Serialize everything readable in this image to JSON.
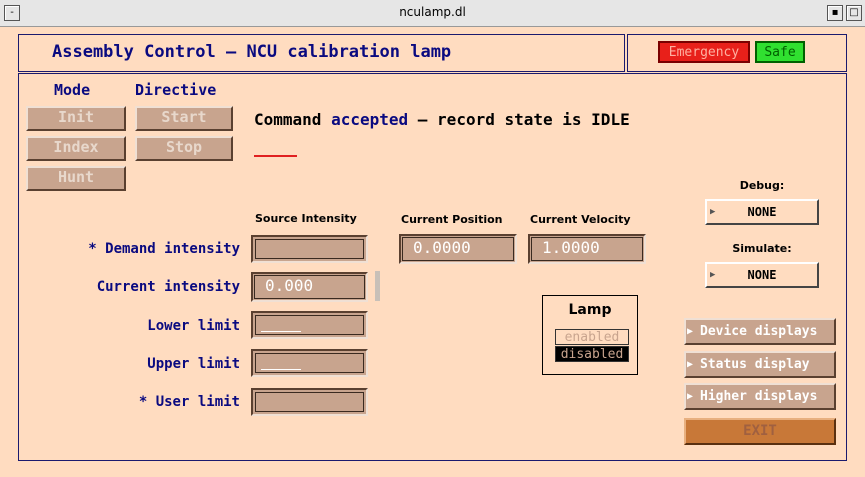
{
  "window": {
    "title": "nculamp.dl"
  },
  "header": {
    "title": "Assembly Control – NCU calibration lamp",
    "emergency_label": "Emergency",
    "safe_label": "Safe"
  },
  "mode": {
    "heading": "Mode",
    "buttons": [
      "Init",
      "Index",
      "Hunt"
    ]
  },
  "directive": {
    "heading": "Directive",
    "buttons": [
      "Start",
      "Stop"
    ]
  },
  "status": {
    "prefix": "Command",
    "word": "accepted",
    "suffix": "– record state is IDLE"
  },
  "columns": {
    "source_intensity": "Source Intensity",
    "current_position": "Current Position",
    "current_velocity": "Current Velocity"
  },
  "rows": {
    "demand_intensity": "* Demand intensity",
    "current_intensity": "Current intensity",
    "lower_limit": "Lower limit",
    "upper_limit": "Upper limit",
    "user_limit": "* User limit"
  },
  "values": {
    "current_intensity": "0.000",
    "current_position": "0.0000",
    "current_velocity": "1.0000"
  },
  "debug": {
    "label": "Debug:",
    "value": "NONE"
  },
  "simulate": {
    "label": "Simulate:",
    "value": "NONE"
  },
  "lamp": {
    "title": "Lamp",
    "enabled": "enabled",
    "disabled": "disabled"
  },
  "nav": {
    "device_displays": "Device displays",
    "status_display": "Status display",
    "higher_displays": "Higher displays",
    "exit": "EXIT"
  },
  "colors": {
    "accent_navy": "#0a0a80",
    "emergency": "#e8201a",
    "safe": "#30e030",
    "background": "#ffdcc0"
  }
}
